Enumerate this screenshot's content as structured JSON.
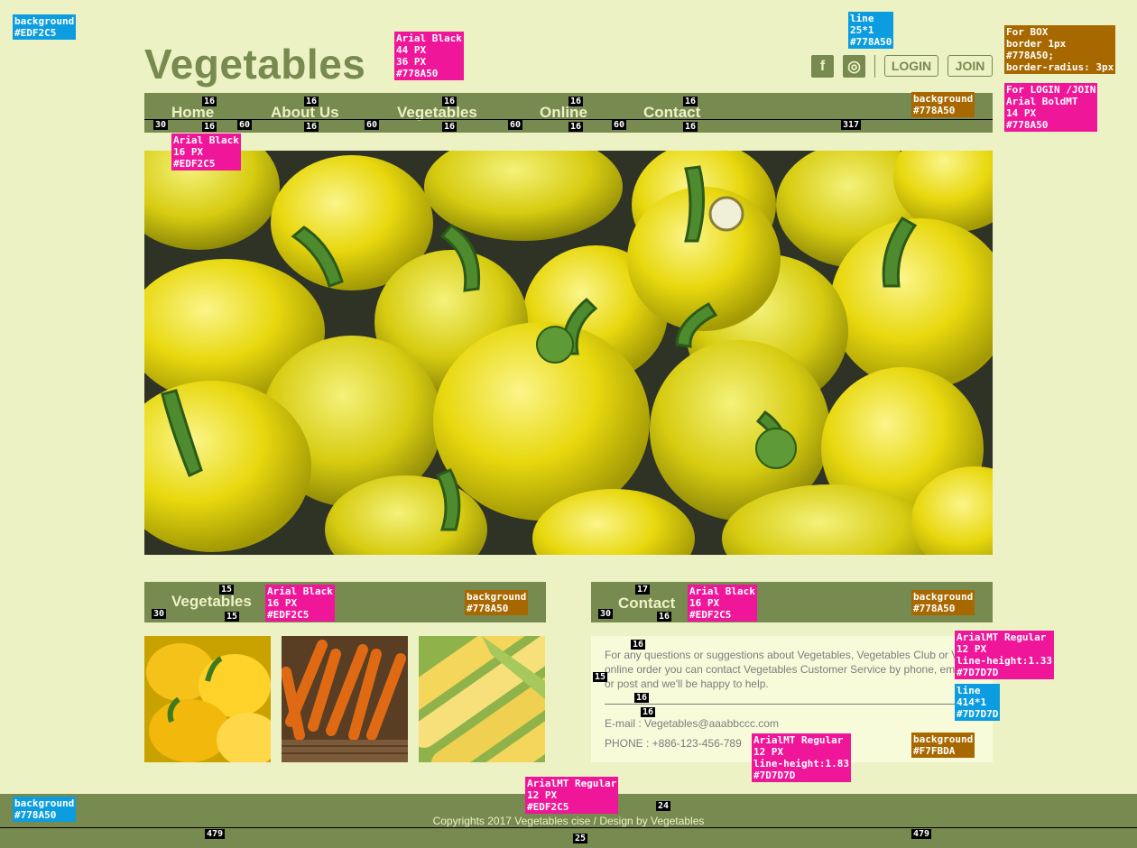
{
  "brand": {
    "logo": "Vegetables"
  },
  "colors": {
    "primary": "#778A50",
    "background": "#EDF2C5",
    "light_box": "#F7FBDA",
    "text_grey": "#7D7D7D"
  },
  "header": {
    "social": [
      {
        "name": "facebook-icon",
        "glyph": "f"
      },
      {
        "name": "instagram-icon",
        "glyph": "◎"
      }
    ],
    "login_label": "LOGIN",
    "join_label": "JOIN"
  },
  "nav": {
    "items": [
      "Home",
      "About Us",
      "Vegetables",
      "Online",
      "Contact"
    ]
  },
  "sections": {
    "vegetables_title": "Vegetables",
    "contact_title": "Contact"
  },
  "contact": {
    "line1": "For any questions or suggestions about Vegetables, Vegetables Club or V",
    "line2": "online order you can contact Vegetables Customer Service by phone, em",
    "line3": "or post and we'll be happy to help.",
    "email": "E-mail : Vegetables@aaabbccc.com",
    "phone": "PHONE : +886-123-456-789"
  },
  "footer": {
    "copyright": "Copyrights 2017 Vegetables cise / Design by Vegetables"
  },
  "annotations": {
    "bg_top": "background\n#EDF2C5",
    "line_top": "line\n25*1\n#778A50",
    "logo_font": "Arial Black\n44 PX\n36 PX\n#778A50",
    "box_spec": "For BOX\nborder 1px\n#778A50;\nborder-radius: 3px",
    "login_spec": "For LOGIN /JOIN\nArial BoldMT\n14 PX\n#778A50",
    "nav_bg": "background\n#778A50",
    "nav_font": "Arial Black\n16 PX\n#EDF2C5",
    "veg_font": "Arial Black\n16 PX\n#EDF2C5",
    "veg_bg": "background\n#778A50",
    "contact_font": "Arial Black\n16 PX\n#EDF2C5",
    "contact_bg": "background\n#778A50",
    "contact_text_spec": "ArialMT Regular\n12 PX\nline-height:1.33\n#7D7D7D",
    "contact_line_spec": "line\n414*1\n#7D7D7D",
    "contact_box_bg": "background\n#F7FBDA",
    "contact_info_spec": "ArialMT Regular\n12 PX\nline-height:1.83\n#7D7D7D",
    "footer_font": "ArialMT Regular\n12 PX\n#EDF2C5",
    "footer_bg": "background\n#778A50"
  },
  "measures": {
    "nav_16": "16",
    "nav_30": "30",
    "nav_60": "60",
    "nav_317": "317",
    "veg_15": "15",
    "veg_30": "30",
    "contact_17": "17",
    "contact_16": "16",
    "contact_30": "30",
    "footer_479": "479",
    "footer_25": "25",
    "footer_24": "24"
  }
}
